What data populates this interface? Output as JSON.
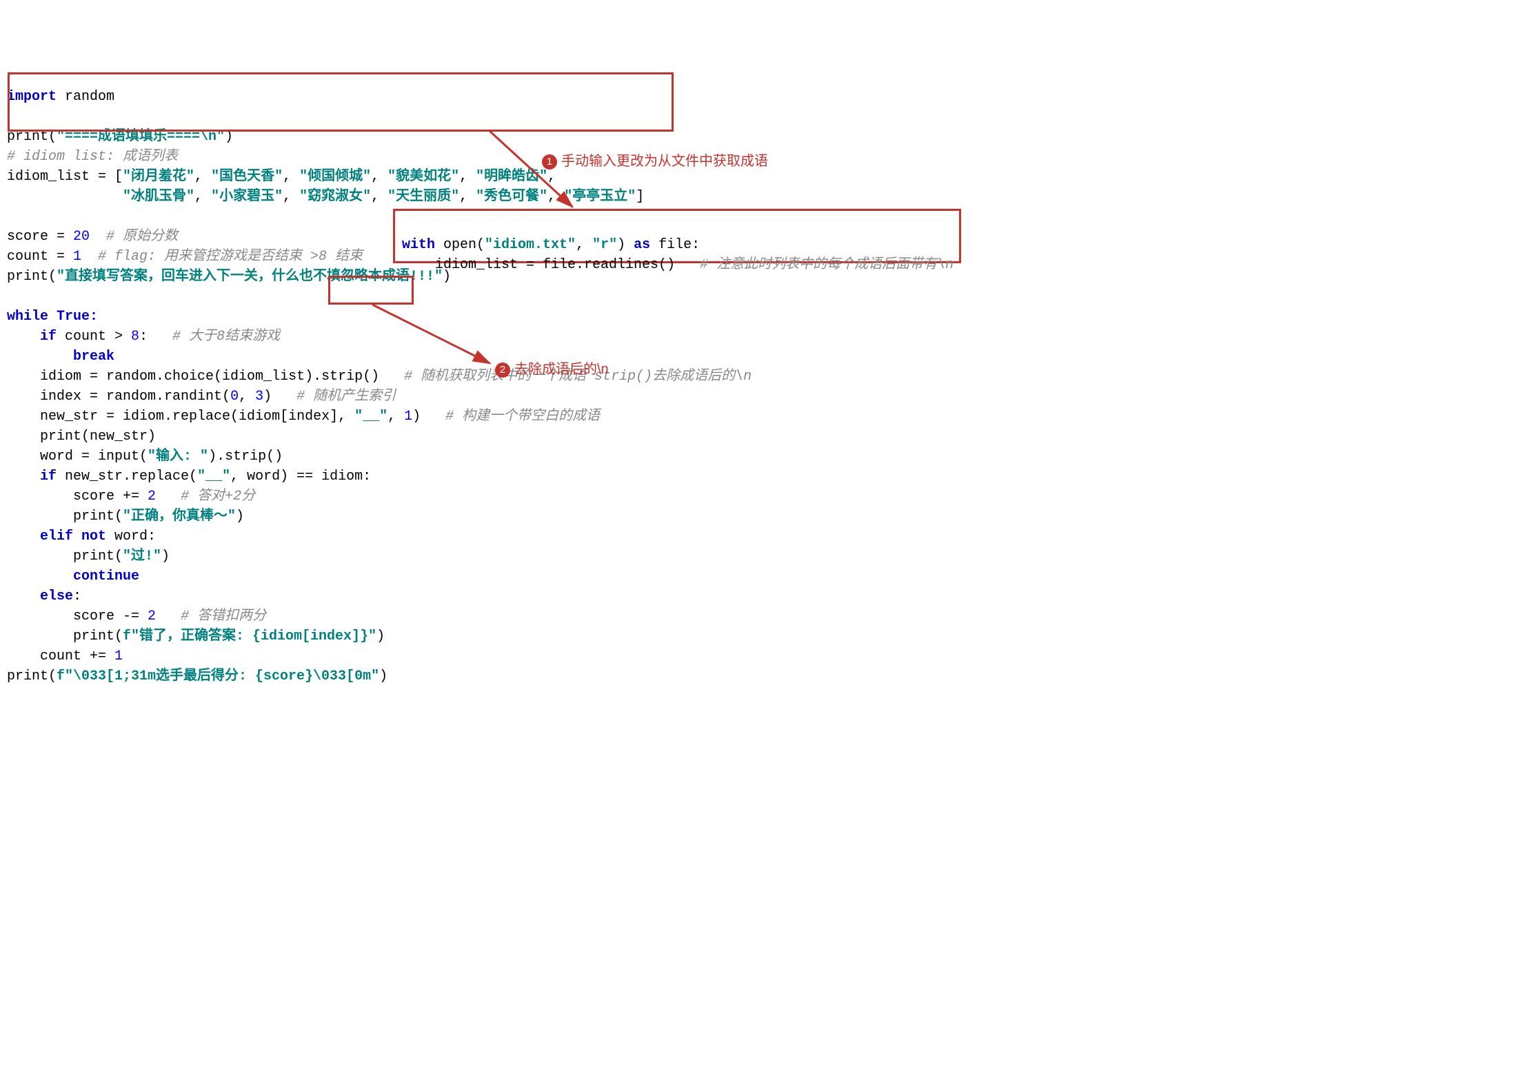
{
  "code": {
    "l1_kw": "import",
    "l1_mod": " random",
    "l3a": "print(",
    "l3s": "\"====成语填填乐====\\n\"",
    "l3b": ")",
    "l4c": "# idiom list: 成语列表",
    "l5a": "idiom_list = [",
    "l5s1": "\"闭月羞花\"",
    "l5c": ", ",
    "l5s2": "\"国色天香\"",
    "l5s3": "\"倾国倾城\"",
    "l5s4": "\"貌美如花\"",
    "l5s5": "\"明眸皓齿\"",
    "l5e": ",",
    "l6pad": "              ",
    "l6s1": "\"冰肌玉骨\"",
    "l6s2": "\"小家碧玉\"",
    "l6s3": "\"窈窕淑女\"",
    "l6s4": "\"天生丽质\"",
    "l6s5": "\"秀色可餐\"",
    "l6s6": "\"亭亭玉立\"",
    "l6b": "]",
    "l8a": "score = ",
    "l8n": "20",
    "l8c": "  # 原始分数",
    "l9a": "count = ",
    "l9n": "1",
    "l9c": "  # flag: 用来管控游戏是否结束 >8 结束",
    "l10a": "print(",
    "l10s": "\"直接填写答案，回车进入下一关，什么也不填忽略本成语!!!\"",
    "l10b": ")",
    "l12a": "while",
    "l12b": " True:",
    "l13a": "    if",
    "l13b": " count > ",
    "l13n": "8",
    "l13c": ":   ",
    "l13cm": "# 大于8结束游戏",
    "l14a": "        break",
    "l15a": "    idiom = random.choice(idiom_list).strip()   ",
    "l15c": "# 随机获取列表中的一个成语 strip()去除成语后的\\n",
    "l16a": "    index = random.randint(",
    "l16n1": "0",
    "l16m": ", ",
    "l16n2": "3",
    "l16b": ")   ",
    "l16c": "# 随机产生索引",
    "l17a": "    new_str = idiom.replace(idiom[index], ",
    "l17s": "\"__\"",
    "l17c": ", ",
    "l17n": "1",
    "l17b": ")   ",
    "l17cm": "# 构建一个带空白的成语",
    "l18a": "    print(new_str)",
    "l19a": "    word = input(",
    "l19s": "\"输入: \"",
    "l19b": ").strip()",
    "l20a": "    if",
    "l20b": " new_str.replace(",
    "l20s": "\"__\"",
    "l20c": ", word) == idiom:",
    "l21a": "        score += ",
    "l21n": "2",
    "l21c": "   # 答对+2分",
    "l22a": "        print(",
    "l22s": "\"正确，你真棒～\"",
    "l22b": ")",
    "l23a": "    elif not",
    "l23b": " word:",
    "l24a": "        print(",
    "l24s": "\"过!\"",
    "l24b": ")",
    "l25a": "        continue",
    "l26a": "    else",
    "l26b": ":",
    "l27a": "        score -= ",
    "l27n": "2",
    "l27c": "   # 答错扣两分",
    "l28a": "        print(",
    "l28s": "f\"错了，正确答案: {idiom[index]}\"",
    "l28b": ")",
    "l29a": "    count += ",
    "l29n": "1",
    "l30a": "print(",
    "l30s": "f\"\\033[1;31m选手最后得分: {score}\\033[0m\"",
    "l30b": ")"
  },
  "inset": {
    "l1a": "with",
    "l1b": " open(",
    "l1s1": "\"idiom.txt\"",
    "l1c": ", ",
    "l1s2": "\"r\"",
    "l1d": ") ",
    "l1e": "as",
    "l1f": " file:",
    "l2a": "    idiom_list = file.readlines()   ",
    "l2c": "# 注意此时列表中的每个成语后面带有\\n"
  },
  "annotations": {
    "a1num": "1",
    "a1txt": "手动输入更改为从文件中获取成语",
    "a2num": "2",
    "a2txt": "去除成语后的\\n"
  }
}
